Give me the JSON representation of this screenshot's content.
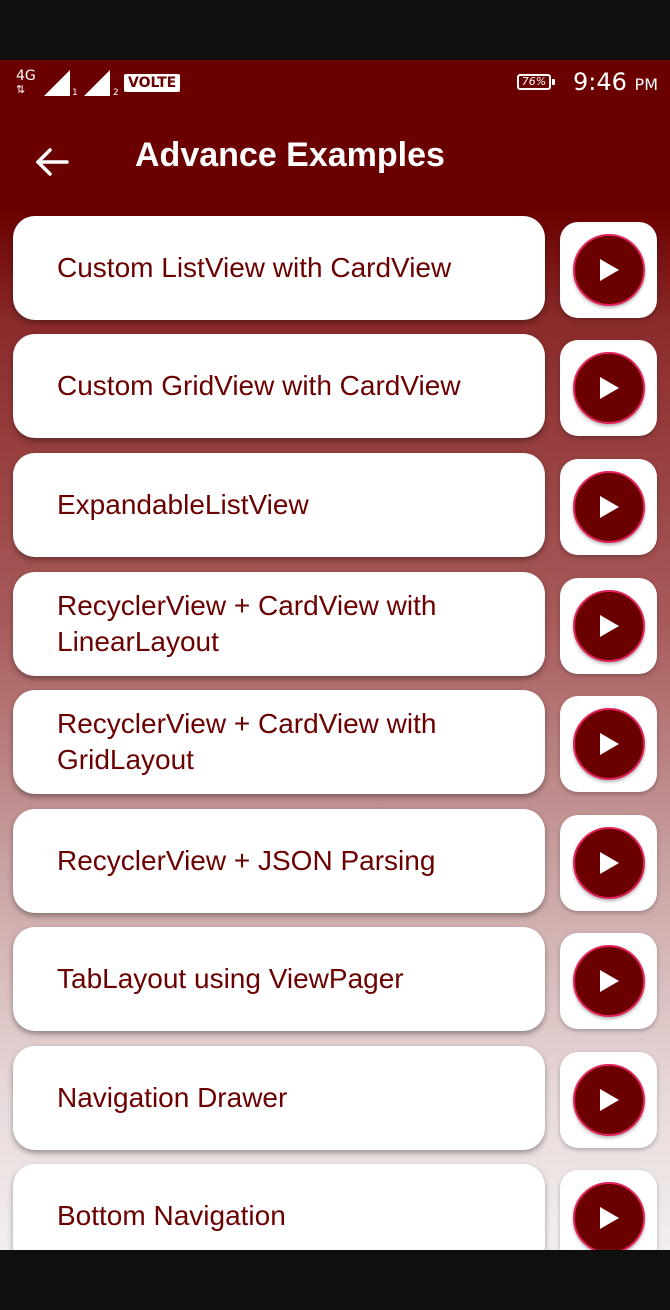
{
  "status_bar": {
    "network": "4G",
    "sim1": "1",
    "sim2": "2",
    "volte": "VOLTE",
    "battery": "76%",
    "time": "9:46",
    "ampm": "PM"
  },
  "app_bar": {
    "title": "Advance Examples",
    "back_icon": "arrow-left-icon"
  },
  "colors": {
    "primary": "#6b0000",
    "accent": "#e0235a",
    "card": "#ffffff"
  },
  "items": [
    {
      "label": "Custom ListView with CardView"
    },
    {
      "label": "Custom GridView with CardView"
    },
    {
      "label": "ExpandableListView"
    },
    {
      "label": "RecyclerView + CardView with LinearLayout"
    },
    {
      "label": "RecyclerView + CardView with GridLayout"
    },
    {
      "label": "RecyclerView + JSON Parsing"
    },
    {
      "label": "TabLayout using ViewPager"
    },
    {
      "label": "Navigation Drawer"
    },
    {
      "label": "Bottom Navigation"
    }
  ],
  "play_icon": "play-icon"
}
